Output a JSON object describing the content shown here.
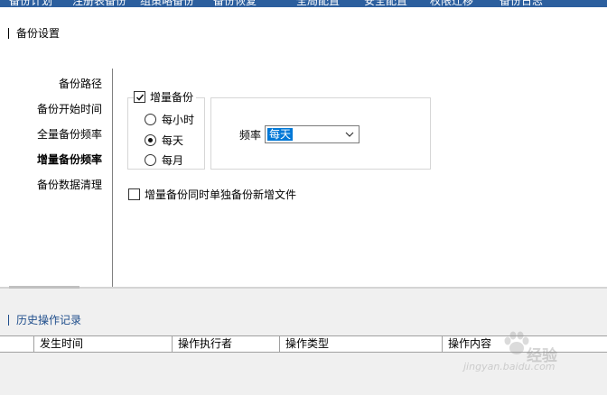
{
  "topnav": {
    "items": [
      {
        "label": "备份计划"
      },
      {
        "label": "注册表备份"
      },
      {
        "label": "组策略备份"
      },
      {
        "label": "备份恢复"
      },
      {
        "label": "全局配置"
      },
      {
        "label": "安全配置"
      },
      {
        "label": "权限迁移"
      },
      {
        "label": "备份日志"
      }
    ]
  },
  "backup_settings": {
    "title": "备份设置",
    "menu": [
      {
        "label": "备份路径",
        "active": false
      },
      {
        "label": "备份开始时间",
        "active": false
      },
      {
        "label": "全量备份频率",
        "active": false
      },
      {
        "label": "增量备份频率",
        "active": true
      },
      {
        "label": "备份数据清理",
        "active": false
      }
    ],
    "incremental": {
      "label": "增量备份",
      "checked": true,
      "options": [
        {
          "label": "每小时",
          "selected": false
        },
        {
          "label": "每天",
          "selected": true
        },
        {
          "label": "每月",
          "selected": false
        }
      ]
    },
    "frequency": {
      "label": "频率",
      "value": "每天"
    },
    "separate_new_files": {
      "label": "增量备份同时单独备份新增文件",
      "checked": false
    }
  },
  "history": {
    "title": "历史操作记录",
    "columns": [
      "发生时间",
      "操作执行者",
      "操作类型",
      "操作内容"
    ]
  },
  "watermark": {
    "brand": "经验",
    "url": "jingyan.baidu.com"
  },
  "colors": {
    "nav_bg": "#2c5f9e",
    "selection": "#0078d7",
    "history_title": "#1f4e8c"
  }
}
